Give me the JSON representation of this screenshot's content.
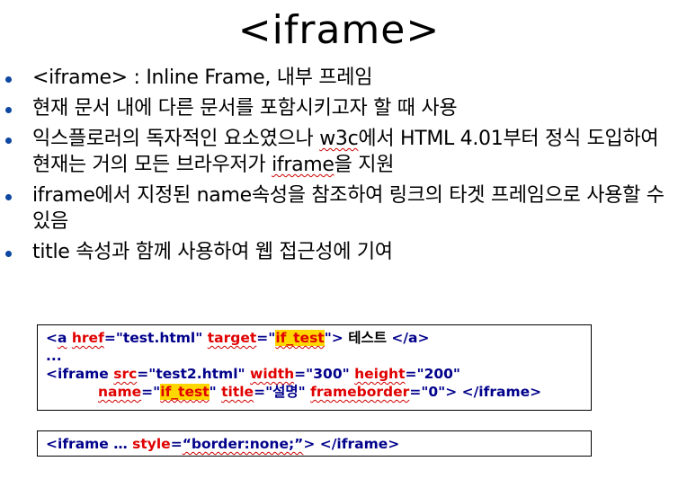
{
  "slide": {
    "title": "<iframe>",
    "bullets": [
      {
        "parts": [
          "<iframe> : Inline Frame, 내부 프레임"
        ]
      },
      {
        "parts": [
          "현재 문서 내에 다른 문서를 포함시키고자 할 때 사용"
        ]
      },
      {
        "parts": [
          "익스플로러의 독자적인 요소였으나 ",
          "w3c",
          "에서 HTML 4.01부터 정식 도입하여 현재는 거의 모든 브라우저가 ",
          "iframe",
          "을 지원"
        ]
      },
      {
        "parts": [
          "iframe에서 지정된 name속성을 참조하여 링크의 타겟 프레임으로 사용할 수 있음"
        ]
      },
      {
        "parts": [
          "title 속성과 함께 사용하여 웹 접근성에 기여"
        ]
      }
    ]
  },
  "code_box_1": {
    "line1": {
      "lt": "<",
      "tag": "a",
      "attr1": "href",
      "eq1": "=",
      "val1": "\"test.html\"",
      "attr2": "target",
      "eq2": "=",
      "q_open": "\"",
      "val2": "if_test",
      "q_close": "\"",
      "gt": ">",
      "text": " 테스트 ",
      "close": "</a>"
    },
    "line2": "...",
    "line3": {
      "lt": "<",
      "tag": "iframe",
      "attr1": "src",
      "eq1": "=",
      "val1": "\"test2.html\"",
      "attr2": "width",
      "eq2": "=",
      "val2": "\"300\"",
      "attr3": "height",
      "eq3": "=",
      "val3": "\"200\""
    },
    "line4": {
      "attr1": "name",
      "eq1": "=",
      "q_open": "\"",
      "val1": "if_test",
      "q_close": "\"",
      "attr2": "title",
      "eq2": "=",
      "val2": "\"설명\"",
      "attr3": "frameborder",
      "eq3": "=",
      "val3": "\"0\"",
      "gt": ">",
      "close": "</iframe>"
    }
  },
  "code_box_2": {
    "lt": "<",
    "tag": "iframe",
    "dots": " … ",
    "attr": "style",
    "eq": "=",
    "val": "“border:none;”",
    "gt": ">",
    "close": "</iframe>"
  },
  "colors": {
    "tag": "#00008b",
    "attribute": "#e00000",
    "highlight": "#ffd700",
    "bullet": "#0d47a1"
  }
}
